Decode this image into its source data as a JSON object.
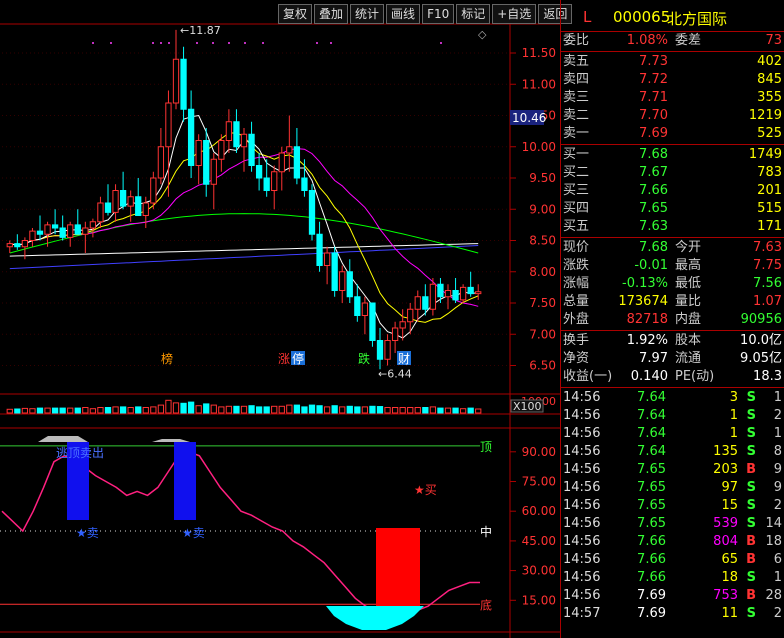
{
  "toolbar": [
    "复权",
    "叠加",
    "统计",
    "画线",
    "F10",
    "标记",
    "+自选",
    "返回"
  ],
  "price_axis": {
    "ticks": [
      "11.50",
      "11.00",
      "10.50",
      "10.00",
      "9.50",
      "9.00",
      "8.50",
      "8.00",
      "7.50",
      "7.00",
      "6.50"
    ],
    "highlight": "10.46",
    "high_label": "11.87",
    "low_label": "6.44"
  },
  "volume_axis": {
    "tick": "10000",
    "unit": "X100"
  },
  "indicator_axis": {
    "ticks": [
      "90.00",
      "75.00",
      "60.00",
      "45.00",
      "30.00",
      "15.00"
    ],
    "top_label": "顶",
    "mid_label": "中",
    "bottom_label": "底"
  },
  "markers": {
    "bang": "榜",
    "zhang": "涨",
    "ting": "停",
    "die": "跌",
    "cai": "财",
    "buy_label": "买",
    "sell_label": "卖",
    "top_escape": "逃顶卖出"
  },
  "colors": {
    "up": "#ff3333",
    "down": "#00ffff",
    "ma5": "#ffffff",
    "ma10": "#ffff00",
    "ma20": "#ff00ff",
    "ma60": "#00ff00",
    "ma120": "#ffffff",
    "ma250": "#4040ff",
    "osc": "#ff2080"
  },
  "chart_data": {
    "type": "candlestick",
    "y_range": [
      6.3,
      11.9
    ],
    "candles": [
      [
        8.4,
        8.5,
        8.3,
        8.45
      ],
      [
        8.45,
        8.6,
        8.35,
        8.4
      ],
      [
        8.4,
        8.55,
        8.2,
        8.5
      ],
      [
        8.5,
        8.7,
        8.4,
        8.65
      ],
      [
        8.65,
        8.9,
        8.5,
        8.6
      ],
      [
        8.6,
        8.8,
        8.4,
        8.75
      ],
      [
        8.75,
        9.0,
        8.6,
        8.7
      ],
      [
        8.7,
        8.9,
        8.5,
        8.55
      ],
      [
        8.55,
        8.8,
        8.4,
        8.75
      ],
      [
        8.75,
        9.0,
        8.6,
        8.6
      ],
      [
        8.6,
        8.8,
        8.3,
        8.7
      ],
      [
        8.7,
        8.85,
        8.55,
        8.8
      ],
      [
        8.8,
        9.2,
        8.7,
        9.1
      ],
      [
        9.1,
        9.4,
        8.9,
        8.95
      ],
      [
        8.95,
        9.4,
        8.8,
        9.3
      ],
      [
        9.3,
        9.6,
        9.0,
        9.05
      ],
      [
        9.05,
        9.3,
        8.8,
        9.2
      ],
      [
        9.2,
        9.5,
        8.9,
        8.9
      ],
      [
        8.9,
        9.2,
        8.7,
        9.1
      ],
      [
        9.1,
        9.6,
        9.0,
        9.5
      ],
      [
        9.5,
        10.3,
        9.4,
        10.0
      ],
      [
        10.0,
        10.9,
        9.2,
        10.7
      ],
      [
        10.7,
        11.87,
        10.6,
        11.4
      ],
      [
        11.4,
        11.6,
        10.4,
        10.6
      ],
      [
        10.6,
        10.9,
        9.5,
        9.7
      ],
      [
        9.7,
        10.2,
        9.4,
        10.1
      ],
      [
        10.1,
        10.3,
        9.2,
        9.4
      ],
      [
        9.4,
        9.9,
        9.0,
        9.8
      ],
      [
        9.8,
        10.2,
        9.6,
        10.1
      ],
      [
        10.1,
        10.6,
        9.9,
        10.4
      ],
      [
        10.4,
        10.6,
        9.9,
        10.0
      ],
      [
        10.0,
        10.3,
        9.6,
        10.2
      ],
      [
        10.2,
        10.4,
        9.6,
        9.7
      ],
      [
        9.7,
        9.9,
        9.3,
        9.5
      ],
      [
        9.5,
        9.8,
        9.2,
        9.3
      ],
      [
        9.3,
        9.7,
        9.0,
        9.6
      ],
      [
        9.6,
        10.0,
        9.3,
        9.9
      ],
      [
        9.9,
        10.5,
        9.6,
        10.0
      ],
      [
        10.0,
        10.3,
        9.4,
        9.5
      ],
      [
        9.5,
        9.8,
        9.2,
        9.3
      ],
      [
        9.3,
        9.4,
        8.5,
        8.6
      ],
      [
        8.6,
        8.8,
        8.0,
        8.1
      ],
      [
        8.1,
        8.4,
        7.8,
        8.3
      ],
      [
        8.3,
        8.4,
        7.6,
        7.7
      ],
      [
        7.7,
        8.1,
        7.5,
        8.0
      ],
      [
        8.0,
        8.2,
        7.5,
        7.6
      ],
      [
        7.6,
        7.8,
        7.2,
        7.3
      ],
      [
        7.3,
        7.6,
        7.0,
        7.5
      ],
      [
        7.5,
        7.5,
        6.8,
        6.9
      ],
      [
        6.9,
        7.1,
        6.44,
        6.6
      ],
      [
        6.6,
        7.0,
        6.5,
        6.9
      ],
      [
        6.9,
        7.2,
        6.7,
        7.1
      ],
      [
        7.1,
        7.4,
        6.9,
        7.2
      ],
      [
        7.2,
        7.5,
        7.0,
        7.4
      ],
      [
        7.4,
        7.7,
        7.2,
        7.6
      ],
      [
        7.6,
        7.8,
        7.3,
        7.4
      ],
      [
        7.4,
        7.9,
        7.3,
        7.8
      ],
      [
        7.8,
        7.9,
        7.5,
        7.6
      ],
      [
        7.6,
        7.8,
        7.4,
        7.7
      ],
      [
        7.7,
        7.9,
        7.5,
        7.55
      ],
      [
        7.55,
        7.8,
        7.5,
        7.75
      ],
      [
        7.75,
        8.0,
        7.6,
        7.65
      ],
      [
        7.65,
        7.8,
        7.55,
        7.68
      ]
    ]
  },
  "quote": {
    "code_prefix": "L",
    "code": "000065",
    "name": "北方国际",
    "weibi_label": "委比",
    "weibi": "1.08%",
    "weicha_label": "委差",
    "weicha": "73",
    "asks": [
      {
        "label": "卖五",
        "price": "7.73",
        "vol": "402"
      },
      {
        "label": "卖四",
        "price": "7.72",
        "vol": "845"
      },
      {
        "label": "卖三",
        "price": "7.71",
        "vol": "355"
      },
      {
        "label": "卖二",
        "price": "7.70",
        "vol": "1219"
      },
      {
        "label": "卖一",
        "price": "7.69",
        "vol": "525"
      }
    ],
    "bids": [
      {
        "label": "买一",
        "price": "7.68",
        "vol": "1749"
      },
      {
        "label": "买二",
        "price": "7.67",
        "vol": "783"
      },
      {
        "label": "买三",
        "price": "7.66",
        "vol": "201"
      },
      {
        "label": "买四",
        "price": "7.65",
        "vol": "515"
      },
      {
        "label": "买五",
        "price": "7.63",
        "vol": "171"
      }
    ],
    "stats": [
      {
        "l1": "现价",
        "v1": "7.68",
        "l2": "今开",
        "v2": "7.63"
      },
      {
        "l1": "涨跌",
        "v1": "-0.01",
        "l2": "最高",
        "v2": "7.75"
      },
      {
        "l1": "涨幅",
        "v1": "-0.13%",
        "l2": "最低",
        "v2": "7.56"
      },
      {
        "l1": "总量",
        "v1": "173674",
        "l2": "量比",
        "v2": "1.07"
      },
      {
        "l1": "外盘",
        "v1": "82718",
        "l2": "内盘",
        "v2": "90956"
      }
    ],
    "fund": [
      {
        "l1": "换手",
        "v1": "1.92%",
        "l2": "股本",
        "v2": "10.0亿"
      },
      {
        "l1": "净资",
        "v1": "7.97",
        "l2": "流通",
        "v2": "9.05亿"
      },
      {
        "l1": "收益(一)",
        "v1": "0.140",
        "l2": "PE(动)",
        "v2": "18.3"
      }
    ],
    "ticks": [
      {
        "t": "14:56",
        "p": "7.64",
        "v": "3",
        "bs": "S",
        "n": "1"
      },
      {
        "t": "14:56",
        "p": "7.64",
        "v": "1",
        "bs": "S",
        "n": "2"
      },
      {
        "t": "14:56",
        "p": "7.64",
        "v": "1",
        "bs": "S",
        "n": "1"
      },
      {
        "t": "14:56",
        "p": "7.64",
        "v": "135",
        "bs": "S",
        "n": "8"
      },
      {
        "t": "14:56",
        "p": "7.65",
        "v": "203",
        "bs": "B",
        "n": "9"
      },
      {
        "t": "14:56",
        "p": "7.65",
        "v": "97",
        "bs": "S",
        "n": "9"
      },
      {
        "t": "14:56",
        "p": "7.65",
        "v": "15",
        "bs": "S",
        "n": "2"
      },
      {
        "t": "14:56",
        "p": "7.65",
        "v": "539",
        "bs": "S",
        "n": "14"
      },
      {
        "t": "14:56",
        "p": "7.66",
        "v": "804",
        "bs": "B",
        "n": "18"
      },
      {
        "t": "14:56",
        "p": "7.66",
        "v": "65",
        "bs": "B",
        "n": "6"
      },
      {
        "t": "14:56",
        "p": "7.66",
        "v": "18",
        "bs": "S",
        "n": "1"
      },
      {
        "t": "14:56",
        "p": "7.69",
        "v": "753",
        "bs": "B",
        "n": "28"
      },
      {
        "t": "14:57",
        "p": "7.69",
        "v": "11",
        "bs": "S",
        "n": "2"
      }
    ]
  }
}
